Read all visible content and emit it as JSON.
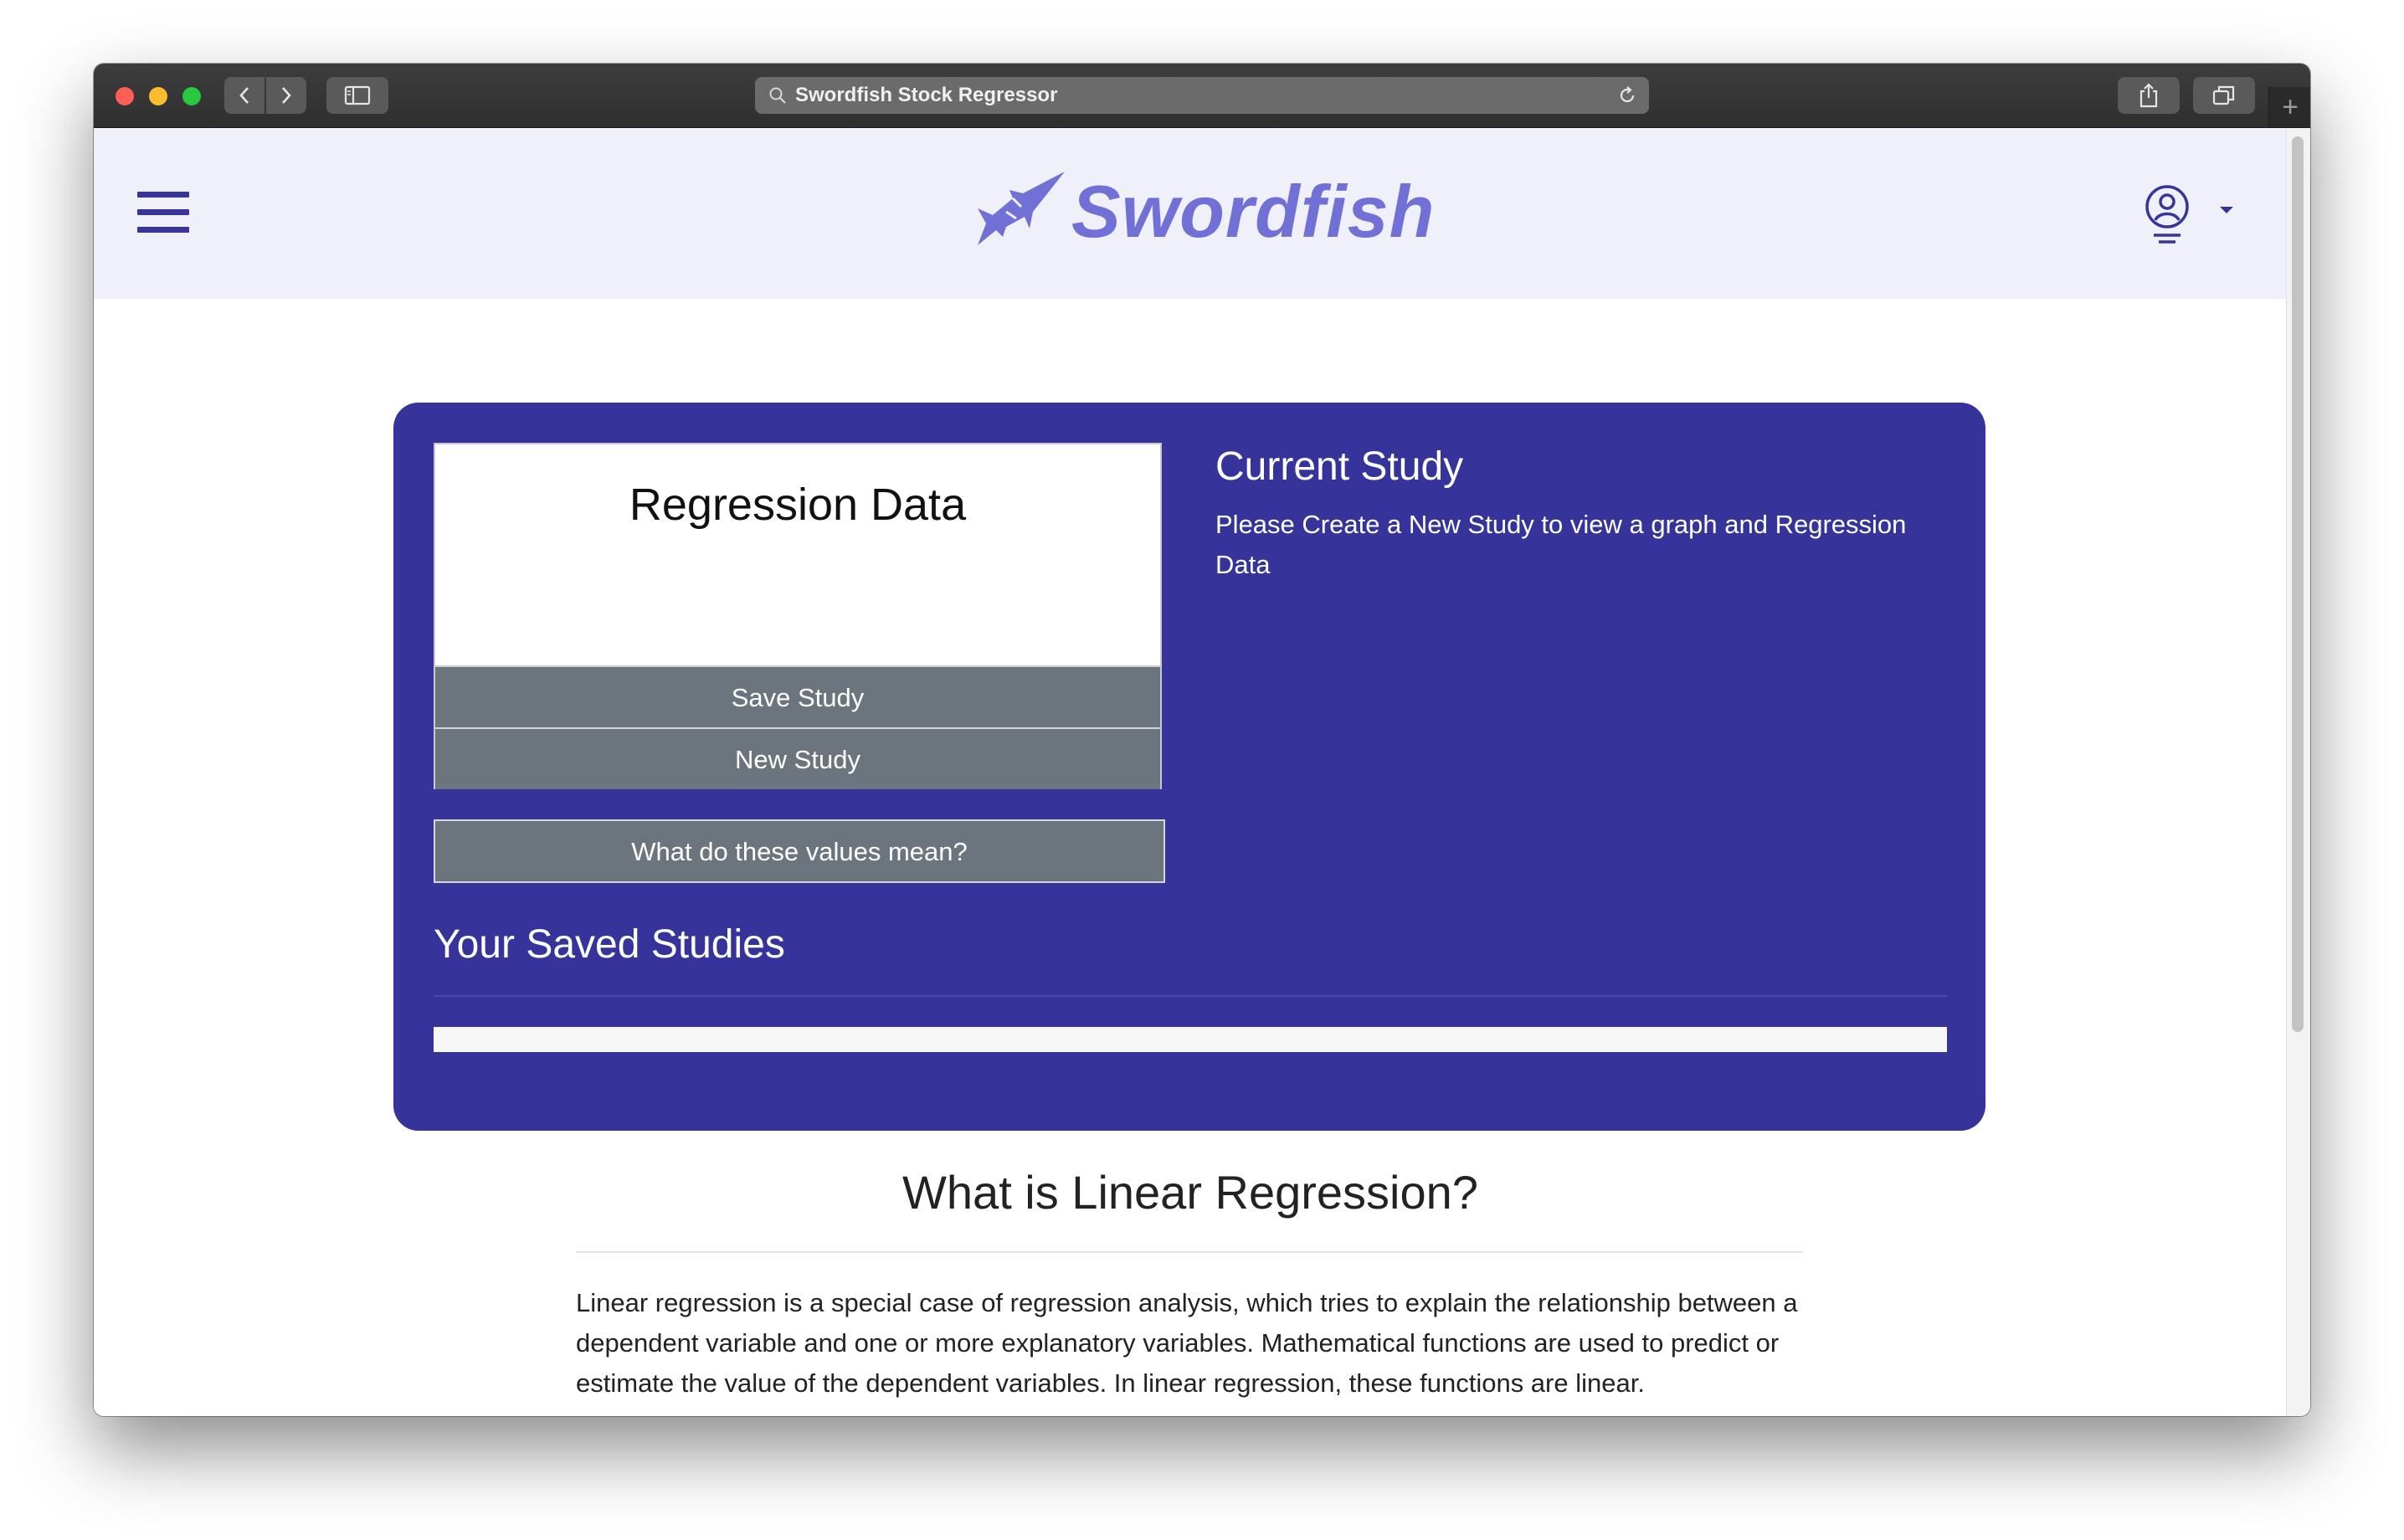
{
  "browser": {
    "url_text": "Swordfish Stock Regressor",
    "new_tab_label": "+"
  },
  "header": {
    "logo_text": "Swordfish"
  },
  "regression_card": {
    "title": "Regression Data",
    "save_label": "Save Study",
    "new_label": "New Study"
  },
  "values_button_label": "What do these values mean?",
  "saved_studies": {
    "heading": "Your Saved Studies"
  },
  "current_study": {
    "heading": "Current Study",
    "message": "Please Create a New Study to view a graph and Regression Data"
  },
  "article": {
    "title": "What is Linear Regression?",
    "paragraph": "Linear regression is a special case of regression analysis, which tries to explain the relationship between a dependent variable and one or more explanatory variables. Mathematical functions are used to predict or estimate the value of the dependent variables. In linear regression, these functions are linear."
  },
  "colors": {
    "brand": "#36339b",
    "logo": "#7070d6",
    "button": "#6c757d",
    "header_bg": "#f0f0fb"
  }
}
